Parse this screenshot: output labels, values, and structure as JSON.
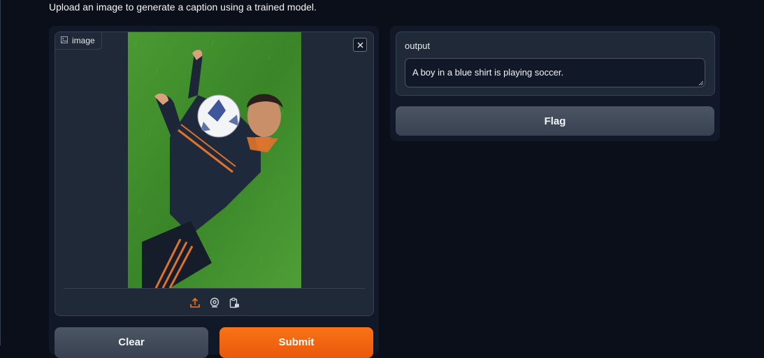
{
  "description": "Upload an image to generate a caption using a trained model.",
  "input": {
    "label": "image",
    "icons": {
      "label": "image-icon",
      "close": "close-icon",
      "upload": "upload-icon",
      "webcam": "webcam-icon",
      "clipboard": "clipboard-icon"
    }
  },
  "output": {
    "label": "output",
    "value": "A boy in a blue shirt is playing soccer."
  },
  "buttons": {
    "clear": "Clear",
    "submit": "Submit",
    "flag": "Flag"
  },
  "colors": {
    "background": "#0b0f19",
    "panel": "#111827",
    "block": "#1f2937",
    "accent": "#f97316"
  }
}
